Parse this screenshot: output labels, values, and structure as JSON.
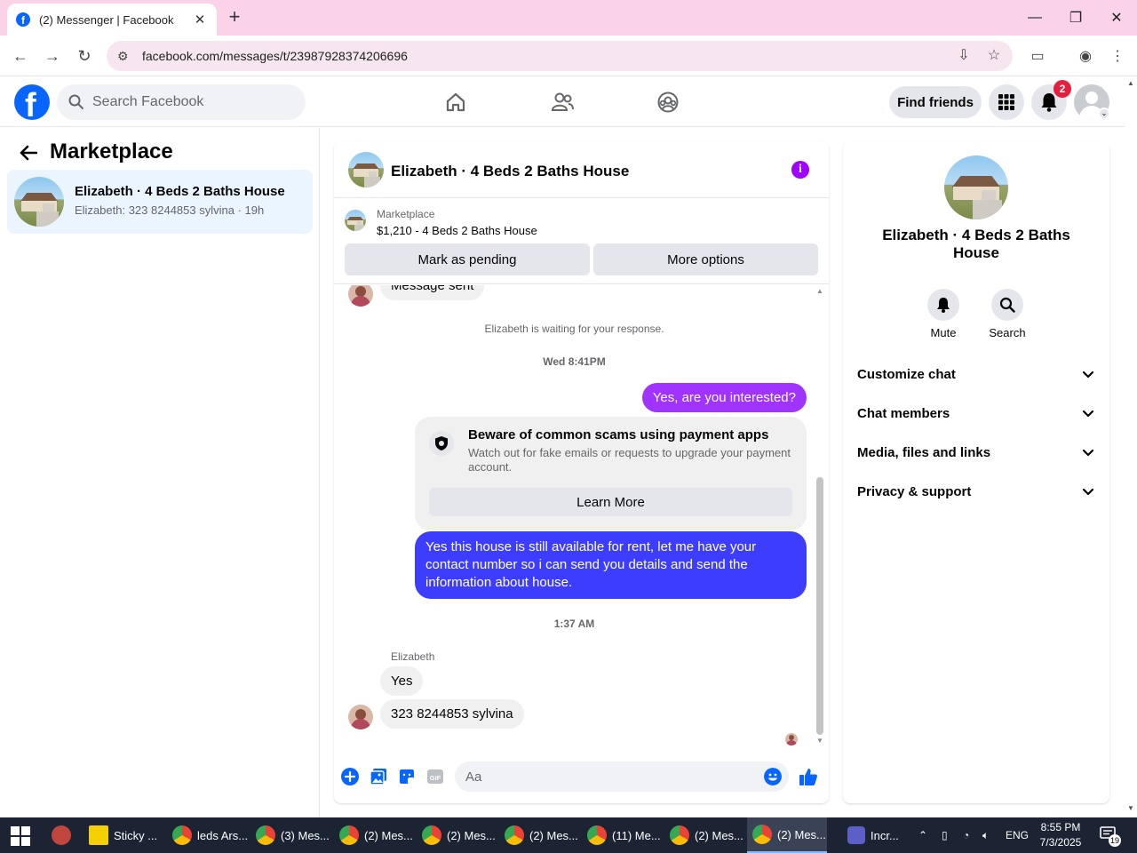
{
  "browser": {
    "tab_title": "(2) Messenger | Facebook",
    "url": "facebook.com/messages/t/23987928374206696"
  },
  "fb_header": {
    "search_placeholder": "Search Facebook",
    "find_friends_label": "Find friends",
    "notifications_count": "2"
  },
  "sidebar": {
    "title": "Marketplace",
    "conversation": {
      "name": "Elizabeth · 4 Beds 2 Baths House",
      "preview": "Elizabeth: 323 8244853 sylvina",
      "time": "19h"
    }
  },
  "chat": {
    "header_name": "Elizabeth · 4 Beds 2 Baths House",
    "listing": {
      "source": "Marketplace",
      "price_title": "$1,210 - 4 Beds 2 Baths House",
      "pending_label": "Mark as pending",
      "more_label": "More options"
    },
    "messages": {
      "cut_message": "Message sent",
      "waiting_note": "Elizabeth is waiting for your response.",
      "timestamp_1": "Wed 8:41PM",
      "out_1": "Yes, are you interested?",
      "scam_title": "Beware of common scams using payment apps",
      "scam_desc": "Watch out for fake emails or requests to upgrade your payment account.",
      "learn_more": "Learn More",
      "out_2": "Yes this house is still available for rent, let me have your contact number so i can send you details and send the information about house.",
      "timestamp_2": "1:37 AM",
      "sender_name": "Elizabeth",
      "in_1": "Yes",
      "in_2": "323 8244853 sylvina"
    },
    "composer_placeholder": "Aa"
  },
  "info_panel": {
    "name": "Elizabeth · 4 Beds 2 Baths House",
    "mute_label": "Mute",
    "search_label": "Search",
    "sections": [
      "Customize chat",
      "Chat members",
      "Media, files and links",
      "Privacy & support"
    ]
  },
  "taskbar": {
    "items": [
      "Sticky ...",
      "leds Ars...",
      "(3) Mes...",
      "(2) Mes...",
      "(2) Mes...",
      "(2) Mes...",
      "(11) Me...",
      "(2) Mes...",
      "(2) Mes..."
    ],
    "app_label": "Incr...",
    "lang": "ENG",
    "time": "8:55 PM",
    "date": "7/3/2025",
    "notif_count": "19"
  },
  "colors": {
    "fb_blue": "#0866ff",
    "out_bubble": "#a033ff",
    "out_bubble_blue": "#3d3dff",
    "selected_conv": "#ebf5ff",
    "tab_strip": "#fbd3e9"
  }
}
